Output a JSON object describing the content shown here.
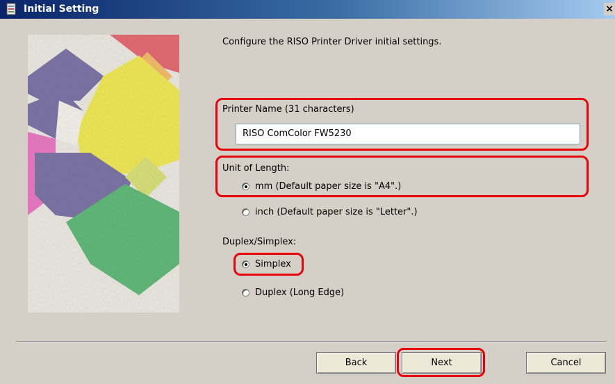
{
  "window": {
    "title": "Initial Setting",
    "close_glyph": "×",
    "icon": "printer-driver-icon"
  },
  "intro_text": "Configure the RISO Printer Driver initial settings.",
  "printer_name": {
    "label": "Printer Name (31 characters)",
    "value": "RISO ComColor FW5230"
  },
  "unit_of_length": {
    "label": "Unit of Length:",
    "options": [
      {
        "label": "mm (Default paper size is \"A4\".)",
        "checked": true
      },
      {
        "label": "inch (Default paper size is \"Letter\".)",
        "checked": false
      }
    ]
  },
  "duplex": {
    "label": "Duplex/Simplex:",
    "options": [
      {
        "label": "Simplex",
        "checked": true
      },
      {
        "label": "Duplex (Long Edge)",
        "checked": false
      }
    ]
  },
  "buttons": {
    "back": "Back",
    "next": "Next",
    "cancel": "Cancel"
  },
  "colors": {
    "highlight": "#e8000b",
    "titlebar": "#0a246a",
    "dialog_bg": "#d4d0c8"
  }
}
